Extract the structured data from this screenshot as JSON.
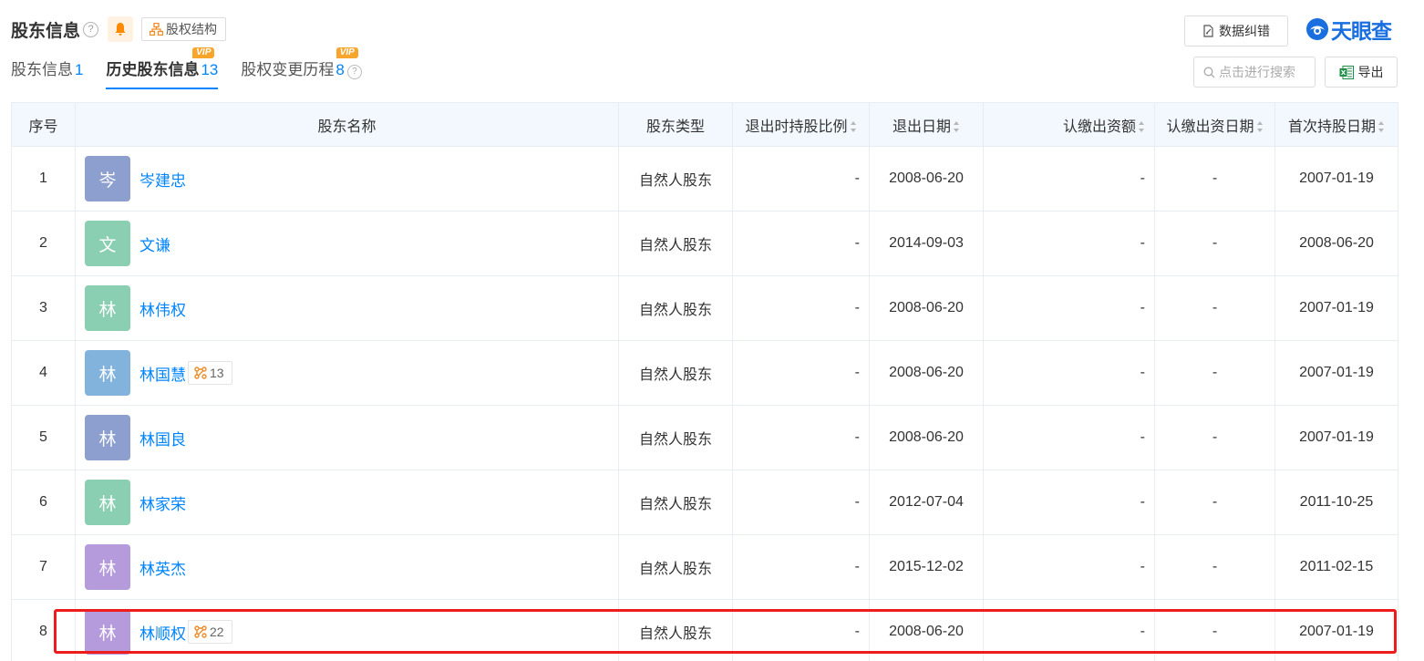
{
  "header": {
    "title": "股东信息",
    "help_glyph": "?",
    "structure_label": "股权结构",
    "report_label": "数据纠错",
    "logo_text": "天眼查",
    "search_placeholder": "点击进行搜索",
    "export_label": "导出",
    "colors": {
      "accent": "#0084ff",
      "vip": "#f7a52b",
      "bell": "#ff8a00",
      "highlight": "#ee1d1d",
      "header_bg": "#f2f8fe"
    }
  },
  "tabs": [
    {
      "label": "股东信息",
      "count": "1",
      "active": false,
      "vip": ""
    },
    {
      "label": "历史股东信息",
      "count": "13",
      "active": true,
      "vip": "VIP"
    },
    {
      "label": "股权变更历程",
      "count": "8",
      "active": false,
      "vip": "VIP",
      "help": "?"
    }
  ],
  "table": {
    "columns": [
      "序号",
      "股东名称",
      "股东类型",
      "退出时持股比例",
      "退出日期",
      "认缴出资额",
      "认缴出资日期",
      "首次持股日期"
    ],
    "rows": [
      {
        "no": "1",
        "avatar": "岑",
        "avatar_color": "#8c9fce",
        "name": "岑建忠",
        "tag": "",
        "type": "自然人股东",
        "ratio": "-",
        "exit_date": "2008-06-20",
        "amount": "-",
        "sub_date": "-",
        "first_date": "2007-01-19"
      },
      {
        "no": "2",
        "avatar": "文",
        "avatar_color": "#8bcfb2",
        "name": "文谦",
        "tag": "",
        "type": "自然人股东",
        "ratio": "-",
        "exit_date": "2014-09-03",
        "amount": "-",
        "sub_date": "-",
        "first_date": "2008-06-20"
      },
      {
        "no": "3",
        "avatar": "林",
        "avatar_color": "#8bcfb2",
        "name": "林伟权",
        "tag": "",
        "type": "自然人股东",
        "ratio": "-",
        "exit_date": "2008-06-20",
        "amount": "-",
        "sub_date": "-",
        "first_date": "2007-01-19"
      },
      {
        "no": "4",
        "avatar": "林",
        "avatar_color": "#82b3dd",
        "name": "林国慧",
        "tag": "13",
        "type": "自然人股东",
        "ratio": "-",
        "exit_date": "2008-06-20",
        "amount": "-",
        "sub_date": "-",
        "first_date": "2007-01-19"
      },
      {
        "no": "5",
        "avatar": "林",
        "avatar_color": "#8c9fce",
        "name": "林国良",
        "tag": "",
        "type": "自然人股东",
        "ratio": "-",
        "exit_date": "2008-06-20",
        "amount": "-",
        "sub_date": "-",
        "first_date": "2007-01-19"
      },
      {
        "no": "6",
        "avatar": "林",
        "avatar_color": "#8bcfb2",
        "name": "林家荣",
        "tag": "",
        "type": "自然人股东",
        "ratio": "-",
        "exit_date": "2012-07-04",
        "amount": "-",
        "sub_date": "-",
        "first_date": "2011-10-25"
      },
      {
        "no": "7",
        "avatar": "林",
        "avatar_color": "#b59bdb",
        "name": "林英杰",
        "tag": "",
        "type": "自然人股东",
        "ratio": "-",
        "exit_date": "2015-12-02",
        "amount": "-",
        "sub_date": "-",
        "first_date": "2011-02-15"
      },
      {
        "no": "8",
        "avatar": "林",
        "avatar_color": "#b59bdb",
        "name": "林顺权",
        "tag": "22",
        "type": "自然人股东",
        "ratio": "-",
        "exit_date": "2008-06-20",
        "amount": "-",
        "sub_date": "-",
        "first_date": "2007-01-19"
      }
    ]
  }
}
